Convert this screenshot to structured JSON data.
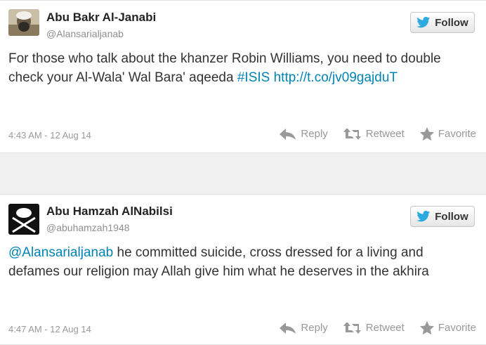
{
  "colors": {
    "link": "#0084b4",
    "twitter_blue": "#2ba9e1",
    "meta": "#999999"
  },
  "tweets": [
    {
      "name": "Abu Bakr Al-Janabi",
      "handle": "@Alansarialjanab",
      "follow_label": "Follow",
      "text_before": "For those who talk about the khanzer Robin Williams, you need to double check your Al-Wala' Wal Bara' aqeeda ",
      "hashtag": "#ISIS",
      "link": "http://t.co/jv09gajduT",
      "text_after": "",
      "timestamp": "4:43 AM - 12 Aug 14",
      "reply_label": "Reply",
      "retweet_label": "Retweet",
      "favorite_label": "Favorite"
    },
    {
      "name": "Abu Hamzah AlNabilsi",
      "handle": "@abuhamzah1948",
      "follow_label": "Follow",
      "mention": "@Alansarialjanab",
      "text_after": " he committed suicide, cross dressed for a living and defames our religion may Allah give him what he deserves in the akhira",
      "timestamp": "4:47 AM - 12 Aug 14",
      "reply_label": "Reply",
      "retweet_label": "Retweet",
      "favorite_label": "Favorite"
    }
  ]
}
